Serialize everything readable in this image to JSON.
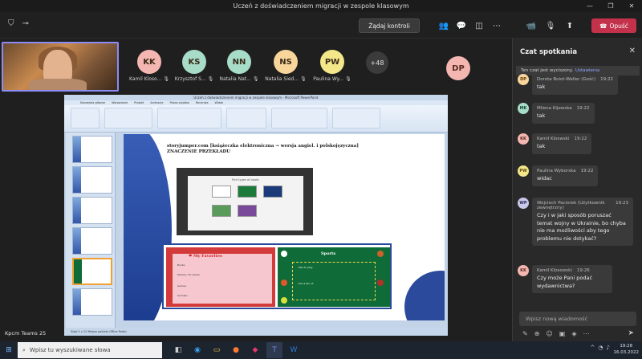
{
  "window": {
    "title": "Uczeń z doświadczeniem migracji w zespole klasowym",
    "controls": [
      "—",
      "❐",
      "✕"
    ]
  },
  "toolbar": {
    "take_control": "Żądaj kontroli",
    "leave_label": "Opuść"
  },
  "participants": [
    {
      "initials": "KK",
      "name": "Kamil Kloso...",
      "color": "#f3b6b0"
    },
    {
      "initials": "KS",
      "name": "Krzysztof S...",
      "color": "#a7dcc8"
    },
    {
      "initials": "NN",
      "name": "Natalia Nat...",
      "color": "#a7dcc8"
    },
    {
      "initials": "NS",
      "name": "Natalia Sied...",
      "color": "#f7d59b"
    },
    {
      "initials": "PW",
      "name": "Paulina Wy...",
      "color": "#f3e78a"
    }
  ],
  "more_count": "+48",
  "spotlight": {
    "initials": "DP",
    "color": "#f3b6b0"
  },
  "shared": {
    "window_title": "Uczeń z doświadczeniem migracji w zespole klasowym - Microsoft PowerPoint",
    "menus": [
      "Narzędzia główne",
      "Wstawianie",
      "Projekt",
      "Animacje",
      "Pokaz slajdów",
      "Recenzja",
      "Widok"
    ],
    "slide_line1": "storyjumper.com  [książeczka elektroniczna → wersja angiel. i polskojęzyczna]",
    "slide_line2": "ZNACZENIE PRZEKŁADU",
    "embed_caption": "Pick types of books",
    "card1_title": "My Favorites",
    "card1_lines": [
      "Books:",
      "Movies / TV shows:",
      "Games:",
      "Animals:"
    ],
    "card2_title": "Sports",
    "card2_lines": [
      "I like to play:",
      "I am a fan of:"
    ],
    "status": "Slajd 1 z 12    Motyw pakietu Office    Polski"
  },
  "presenter_label": "Kpcm Teams 25",
  "chat": {
    "title": "Czat spotkania",
    "notice": "Ten czat jest wyciszony.",
    "notice_link": "Ustawienia",
    "messages": [
      {
        "initials": "DP",
        "name": "Dorota Boiot-Weller (Gość)",
        "time": "19:22",
        "text": "tak",
        "color": "#f7d59b"
      },
      {
        "initials": "MK",
        "name": "Milena Kijewska",
        "time": "19:22",
        "text": "tak",
        "color": "#a7dcc8"
      },
      {
        "initials": "KK",
        "name": "Kamil Kloswski",
        "time": "19:22",
        "text": "tak",
        "color": "#f3b6b0"
      },
      {
        "initials": "PW",
        "name": "Paulina Wyborska",
        "time": "19:22",
        "text": "widac",
        "color": "#f3e78a"
      },
      {
        "initials": "WP",
        "name": "Wojciech Paciorek (Użytkownik zewnętrzny)",
        "time": "19:23",
        "text": "Czy i w jaki sposób poruszać temat wojny w Ukrainie, bo chyba nie ma możliwości aby tego problemu nie dotykać?",
        "color": "#c8c8e8"
      },
      {
        "initials": "KK",
        "name": "Kamil Klosowski",
        "time": "19:26",
        "text": "Czy może Pani podać wydawnictwa?",
        "color": "#f3b6b0"
      }
    ],
    "compose_placeholder": "Wpisz nową wiadomość"
  },
  "taskbar": {
    "search_placeholder": "Wpisz tu wyszukiwane słowa",
    "time": "19:28",
    "date": "16.03.2022"
  }
}
